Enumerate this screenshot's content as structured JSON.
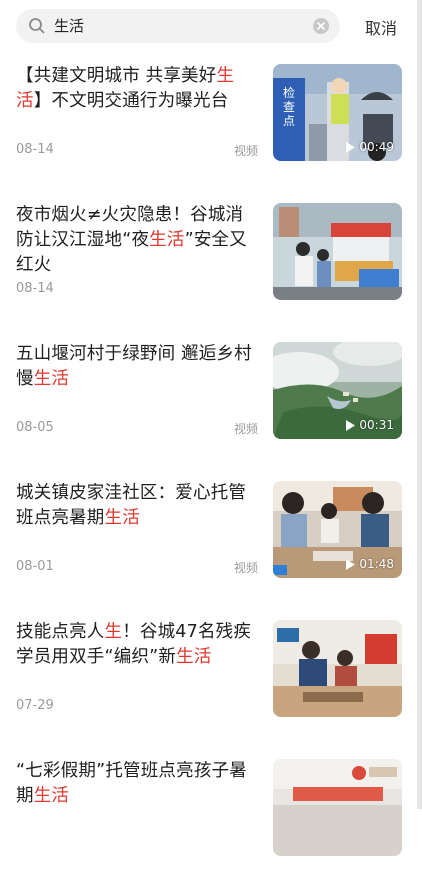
{
  "search": {
    "query": "生活",
    "cancel_label": "取消",
    "icons": [
      "search-icon",
      "clear-icon"
    ]
  },
  "colors": {
    "highlight": "#e0382f",
    "meta_text": "#9a9a9a",
    "search_bg": "#f2f2f2"
  },
  "results": [
    {
      "title": [
        {
          "t": "【共建文明城市 共享美好"
        },
        {
          "t": "生活",
          "hl": true
        },
        {
          "t": "】不文明交通行为曝光台"
        }
      ],
      "date": "08-14",
      "type": "视频",
      "duration": "00:49",
      "thumb_text": [
        "检",
        "查",
        "点"
      ]
    },
    {
      "title": [
        {
          "t": "夜市烟火≠火灾隐患！谷城消防让汉江湿地“夜"
        },
        {
          "t": "生活",
          "hl": true
        },
        {
          "t": "”安全又红火"
        }
      ],
      "date": "08-14",
      "type": "",
      "duration": ""
    },
    {
      "title": [
        {
          "t": "五山堰河村于绿野间 邂逅乡村慢"
        },
        {
          "t": "生活",
          "hl": true
        }
      ],
      "date": "08-05",
      "type": "视频",
      "duration": "00:31"
    },
    {
      "title": [
        {
          "t": "城关镇皮家洼社区：爱心托管班点亮暑期"
        },
        {
          "t": "生活",
          "hl": true
        }
      ],
      "date": "08-01",
      "type": "视频",
      "duration": "01:48"
    },
    {
      "title": [
        {
          "t": "技能点亮人"
        },
        {
          "t": "生",
          "hl": true
        },
        {
          "t": "！谷城47名残疾学员用双手“编织”新"
        },
        {
          "t": "生活",
          "hl": true
        }
      ],
      "date": "07-29",
      "type": "",
      "duration": ""
    },
    {
      "title": [
        {
          "t": "“七彩假期”托管班点亮孩子暑期"
        },
        {
          "t": "生活",
          "hl": true
        }
      ],
      "date": "",
      "type": "",
      "duration": ""
    }
  ]
}
